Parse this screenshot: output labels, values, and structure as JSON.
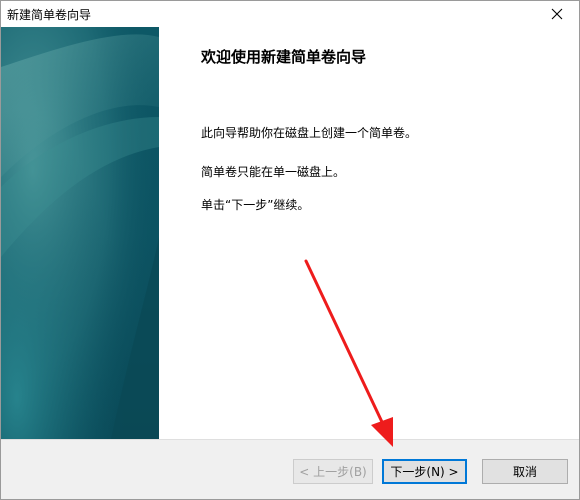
{
  "window": {
    "title": "新建简单卷向导"
  },
  "page": {
    "heading": "欢迎使用新建简单卷向导",
    "paragraphs": [
      "此向导帮助你在磁盘上创建一个简单卷。",
      "简单卷只能在单一磁盘上。",
      "单击“下一步”继续。"
    ]
  },
  "buttons": {
    "back": "< 上一步(B)",
    "next": "下一步(N) >",
    "cancel": "取消"
  },
  "colors": {
    "panel_dark": "#0b4f5c",
    "panel_light": "#3c8f96",
    "accent_focus": "#0078d7",
    "annotation_arrow": "#ee1c1c"
  },
  "icons": {
    "close": "close-icon",
    "annotation": "annotation-arrow"
  }
}
